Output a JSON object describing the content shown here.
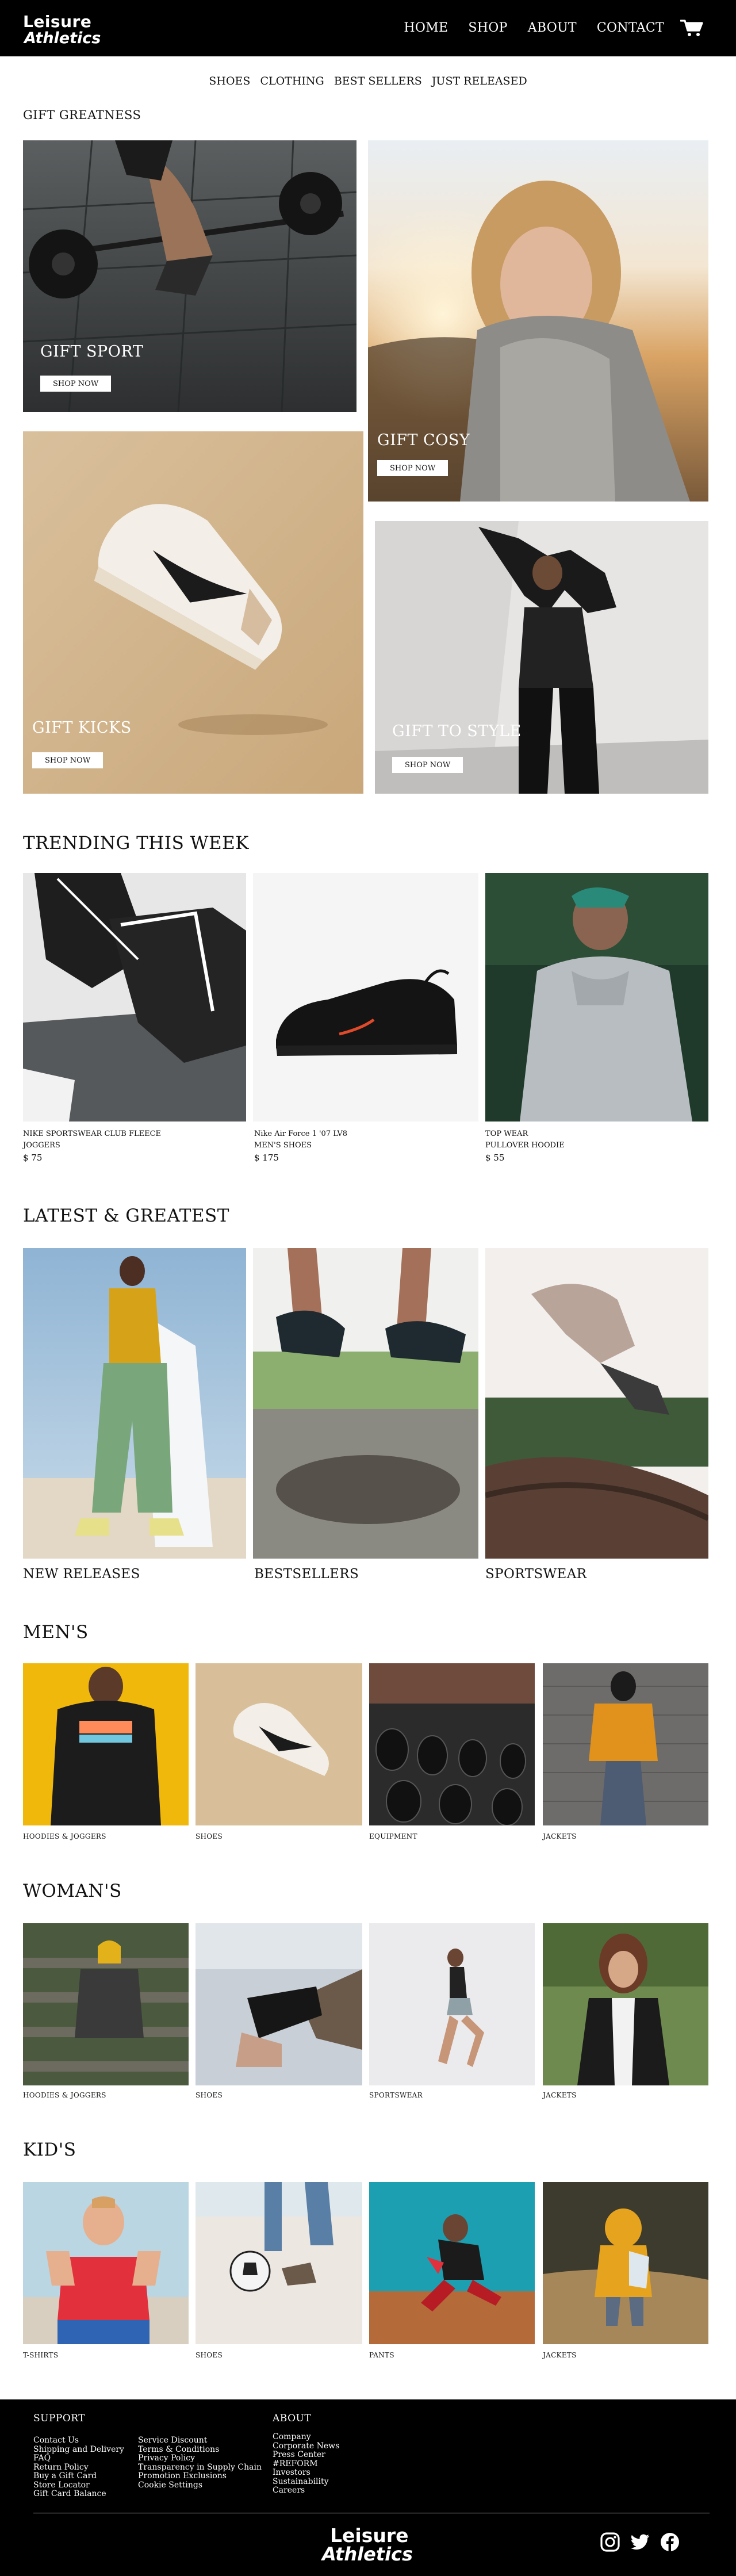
{
  "brand": {
    "name_line1": "Leisure",
    "name_line2": "Athletics"
  },
  "colors": {
    "header_bg": "#000000",
    "page_bg": "#ffffff",
    "text": "#111111"
  },
  "topnav": [
    {
      "label": "HOME"
    },
    {
      "label": "SHOP"
    },
    {
      "label": "ABOUT"
    },
    {
      "label": "CONTACT"
    }
  ],
  "cart_icon": "cart-icon",
  "subnav": [
    "SHOES",
    "CLOTHING",
    "BEST SELLERS",
    "JUST RELEASED"
  ],
  "gift": {
    "title": "GIFT GREATNESS",
    "tiles": [
      {
        "label": "GIFT SPORT",
        "button": "SHOP NOW"
      },
      {
        "label": "GIFT COSY",
        "button": "SHOP NOW"
      },
      {
        "label": "GIFT KICKS",
        "button": "SHOP NOW"
      },
      {
        "label": "GIFT TO STYLE",
        "button": "SHOP NOW"
      }
    ]
  },
  "trending": {
    "title": "TRENDING THIS WEEK",
    "items": [
      {
        "line1": "NIKE SPORTSWEAR CLUB FLEECE",
        "line2": "JOGGERS",
        "price": "$ 75"
      },
      {
        "line1": "Nike Air Force 1 '07 LV8",
        "line2": "MEN'S SHOES",
        "price": "$ 175"
      },
      {
        "line1": "TOP WEAR",
        "line2": "PULLOVER HOODIE",
        "price": "$ 55"
      }
    ]
  },
  "latest": {
    "title": "LATEST & GREATEST",
    "items": [
      {
        "label": "NEW RELEASES"
      },
      {
        "label": "BESTSELLERS"
      },
      {
        "label": "SPORTSWEAR"
      }
    ]
  },
  "mens": {
    "title": "MEN'S",
    "items": [
      {
        "label": "HOODIES & JOGGERS"
      },
      {
        "label": "SHOES"
      },
      {
        "label": "EQUIPMENT"
      },
      {
        "label": "JACKETS"
      }
    ]
  },
  "womans": {
    "title": "WOMAN'S",
    "items": [
      {
        "label": "HOODIES & JOGGERS"
      },
      {
        "label": "SHOES"
      },
      {
        "label": "SPORTSWEAR"
      },
      {
        "label": "JACKETS"
      }
    ]
  },
  "kids": {
    "title": "KID'S",
    "items": [
      {
        "label": "T-SHIRTS"
      },
      {
        "label": "SHOES"
      },
      {
        "label": "PANTS"
      },
      {
        "label": "JACKETS"
      }
    ]
  },
  "footer": {
    "support_title": "SUPPORT",
    "support_col1": [
      "Contact Us",
      "Shipping and Delivery",
      "FAQ",
      "Return Policy",
      "Buy a Gift Card",
      "Store Locator",
      "Gift Card Balance"
    ],
    "support_col2": [
      "Service Discount",
      "Terms & Conditions",
      "Privacy Policy",
      "Transparency in Supply Chain",
      "Promotion Exclusions",
      "Cookie Settings"
    ],
    "about_title": "ABOUT",
    "about_list": [
      "Company",
      "Corporate News",
      "Press Center",
      "#REFORM",
      "Investors",
      "Sustainability",
      "Careers"
    ],
    "social_icons": [
      "instagram-icon",
      "twitter-icon",
      "facebook-icon"
    ]
  }
}
